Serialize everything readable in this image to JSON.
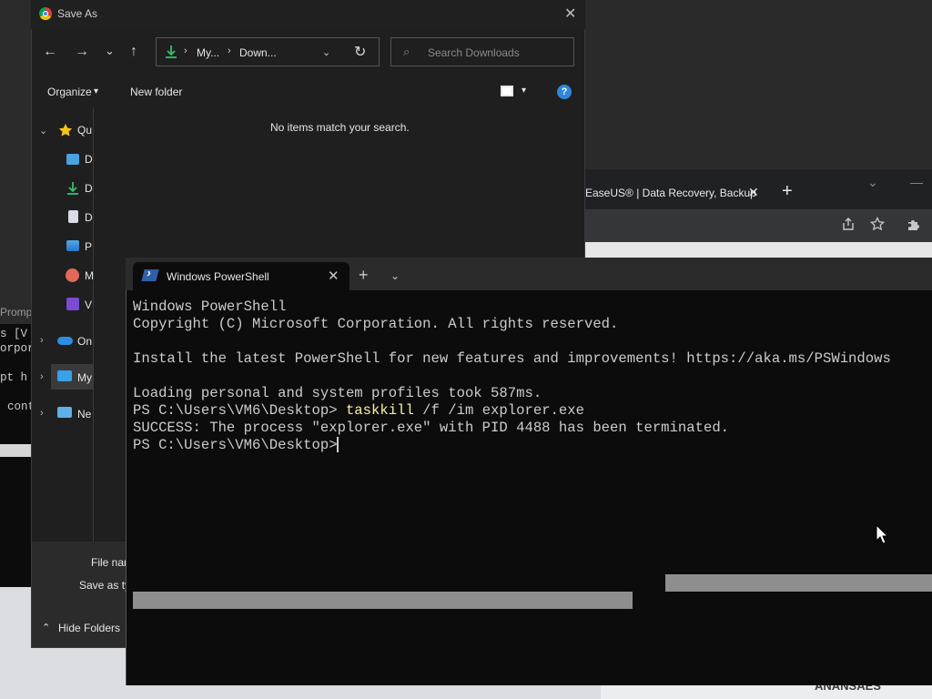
{
  "background": {
    "bottom_text": "ANANSAES"
  },
  "cmd_window": {
    "title": "Prompt",
    "lines": [
      "s [V",
      "orpor",
      "",
      "pt h",
      "cont"
    ]
  },
  "chrome": {
    "tab_title": "EaseUS® | Data Recovery, Backup",
    "tab_close": "✕",
    "new_tab": "+",
    "chevron": "⌄",
    "minimize": "—",
    "icons": [
      "share-icon",
      "star-icon",
      "extensions-icon"
    ]
  },
  "save_dialog": {
    "title": "Save As",
    "close": "✕",
    "nav": {
      "back": "←",
      "forward": "→",
      "recent": "⌄",
      "up": "↑"
    },
    "address": {
      "crumb1": "My...",
      "crumb2": "Down...",
      "sep": "›",
      "drop": "⌄",
      "refresh": "↻"
    },
    "search": {
      "placeholder": "Search Downloads",
      "icon": "⌕"
    },
    "commandbar": {
      "organize": "Organize",
      "organize_drop": "▾",
      "new_folder": "New folder",
      "view_drop": "▾",
      "help": "?"
    },
    "nav_pane": {
      "items": [
        {
          "label": "Qu",
          "chev": "⌄",
          "icon": "star-icon"
        },
        {
          "label": "D",
          "icon": "desktop-icon"
        },
        {
          "label": "D",
          "icon": "download-icon"
        },
        {
          "label": "D",
          "icon": "document-icon"
        },
        {
          "label": "P",
          "icon": "pictures-icon"
        },
        {
          "label": "M",
          "icon": "music-icon"
        },
        {
          "label": "V",
          "icon": "videos-icon"
        },
        {
          "label": "On",
          "chev": "›",
          "icon": "onedrive-icon"
        },
        {
          "label": "My",
          "chev": "›",
          "icon": "this-pc-icon"
        },
        {
          "label": "Ne",
          "chev": "›",
          "icon": "network-icon"
        }
      ]
    },
    "empty_message": "No items match your search.",
    "file_name_label": "File nar",
    "save_as_type_label": "Save as ty",
    "hide_folders": "Hide Folders",
    "hide_chev": "⌃"
  },
  "powershell": {
    "tab_title": "Windows PowerShell",
    "tab_close": "✕",
    "new_tab": "+",
    "dropdown": "⌄",
    "lines": [
      "Windows PowerShell",
      "Copyright (C) Microsoft Corporation. All rights reserved.",
      "",
      "Install the latest PowerShell for new features and improvements! https://aka.ms/PSWindows",
      "",
      "Loading personal and system profiles took 587ms."
    ],
    "prompt1": "PS C:\\Users\\VM6\\Desktop> ",
    "command1": "taskkill",
    "args1": " /f /im explorer.exe",
    "output1": "SUCCESS: The process \"explorer.exe\" with PID 4488 has been terminated.",
    "prompt2": "PS C:\\Users\\VM6\\Desktop> "
  }
}
